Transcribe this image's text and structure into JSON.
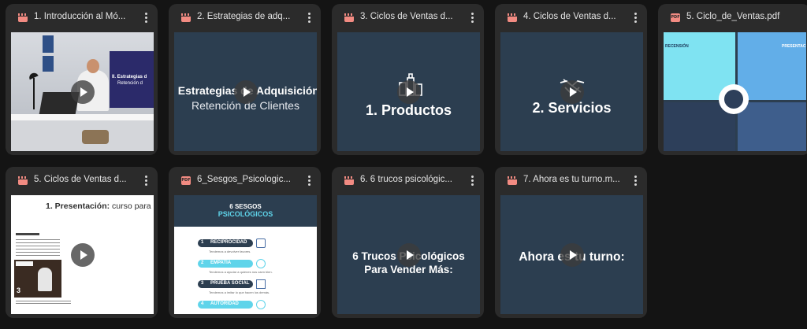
{
  "files": [
    {
      "type": "video",
      "title": "1. Introducción al Mó..."
    },
    {
      "type": "video",
      "title": "2. Estrategias de adq...",
      "slide": {
        "line1": ". Estrategias de Adquisición",
        "line2": "Retención de Clientes"
      }
    },
    {
      "type": "video",
      "title": "3. Ciclos de Ventas d...",
      "slide": {
        "heading": "1. Productos"
      }
    },
    {
      "type": "video",
      "title": "4. Ciclos de Ventas d...",
      "slide": {
        "heading": "2. Servicios"
      }
    },
    {
      "type": "pdf",
      "title": "5. Ciclo_de_Ventas.pdf",
      "slide": {
        "left_label": "RECENSIÓN",
        "right_label": "PRESENTAC"
      }
    },
    {
      "type": "video",
      "title": "5. Ciclos de Ventas d...",
      "slide": {
        "heading_bold": "1. Presentación:",
        "heading_rest": " curso para pri",
        "badge": "3"
      }
    },
    {
      "type": "pdf",
      "title": "6_Sesgos_Psicologic...",
      "slide": {
        "title1": "6 SESGOS",
        "title2": "PSICOLÓGICOS",
        "items": [
          {
            "num": "1",
            "label": "RECIPROCIDAD",
            "desc": "Tendemos a devolver favores."
          },
          {
            "num": "2",
            "label": "EMPATÍA",
            "desc": "Tendemos a ayudar a quienes nos caen bien."
          },
          {
            "num": "3",
            "label": "PRUEBA SOCIAL",
            "desc": "Tendemos a imitar lo que hacen los demás."
          },
          {
            "num": "4",
            "label": "AUTORIDAD",
            "desc": ""
          }
        ]
      }
    },
    {
      "type": "video",
      "title": "6. 6 trucos psicológic...",
      "slide": {
        "line1": "6 Trucos Psicológicos",
        "line2": "Para Vender Más:"
      }
    },
    {
      "type": "video",
      "title": "7. Ahora es tu turno.m...",
      "slide": {
        "heading": "Ahora es tu turno:"
      }
    }
  ],
  "intro_slide": {
    "line1": "II. Estrategias d",
    "line2": "Retención d"
  },
  "pdf_badge": "PDF",
  "colors": {
    "background": "#141414",
    "card": "#2b2b2b",
    "slide": "#2c3e50",
    "icon": "#f28b82"
  }
}
